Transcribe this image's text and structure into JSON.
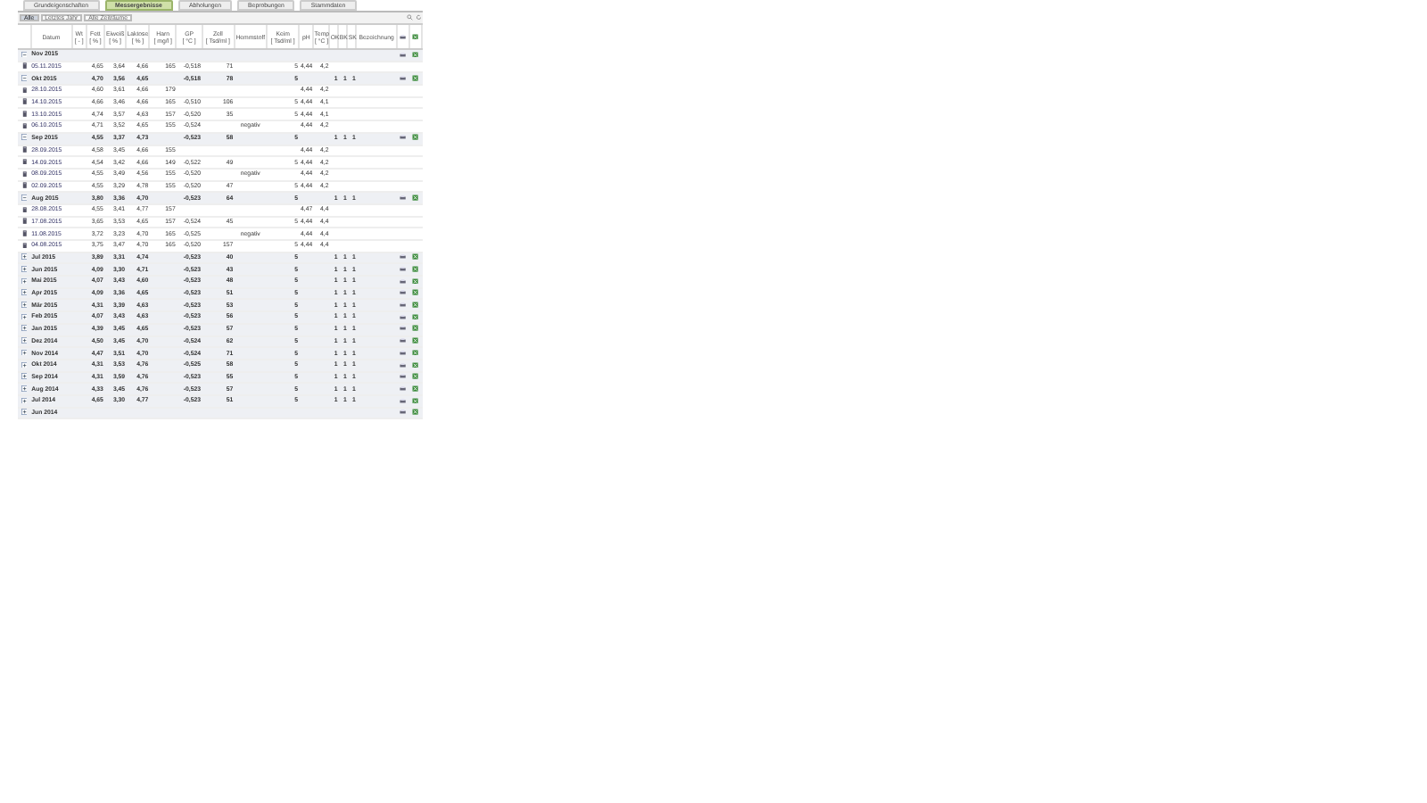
{
  "tabs": [
    {
      "label": "Grundeigenschaften",
      "selected": false
    },
    {
      "label": "Messergebnisse",
      "selected": true
    },
    {
      "label": "Abholungen",
      "selected": false
    },
    {
      "label": "Beprobungen",
      "selected": false
    },
    {
      "label": "Stammdaten",
      "selected": false
    }
  ],
  "filters": [
    {
      "label": "Alle",
      "selected": true
    },
    {
      "label": "Letztes Jahr",
      "selected": false
    },
    {
      "label": "Alle Zeiträume",
      "selected": false
    }
  ],
  "table": {
    "columns": [
      {
        "label": "Datum"
      },
      {
        "label": "Wt",
        "unit": "[ - ]"
      },
      {
        "label": "Fett",
        "unit": "[ % ]"
      },
      {
        "label": "Eiweiß",
        "unit": "[ % ]"
      },
      {
        "label": "Laktose",
        "unit": "[ % ]"
      },
      {
        "label": "Harn",
        "unit": "[ mg/l ]"
      },
      {
        "label": "GP",
        "unit": "[ °C ]"
      },
      {
        "label": "Zell",
        "unit": "[ Tsd/ml ]"
      },
      {
        "label": "Hemmstoff"
      },
      {
        "label": "Keim",
        "unit": "[ Tsd/ml ]"
      },
      {
        "label": "pH"
      },
      {
        "label": "Temp",
        "unit": "[ °C ]"
      },
      {
        "label": "OK"
      },
      {
        "label": "BK"
      },
      {
        "label": "SK"
      },
      {
        "label": "Bezeichnung"
      }
    ],
    "rows": [
      {
        "kind": "month",
        "expanded": true,
        "cells": [
          "Nov 2015"
        ]
      },
      {
        "kind": "measurement",
        "cells": [
          "05.11.2015",
          "",
          "4,65",
          "3,64",
          "4,66",
          "165",
          "-0,518",
          "71",
          "",
          "5",
          "4,44",
          "4,2"
        ]
      },
      {
        "kind": "month",
        "expanded": true,
        "cells": [
          "Okt 2015",
          "",
          "4,70",
          "3,56",
          "4,65",
          "",
          "-0,518",
          "78",
          "",
          "5",
          "",
          "",
          "1",
          "1",
          "1"
        ]
      },
      {
        "kind": "measurement",
        "cells": [
          "28.10.2015",
          "",
          "4,60",
          "3,61",
          "4,66",
          "179",
          "",
          "",
          "",
          "",
          "4,44",
          "4,2"
        ]
      },
      {
        "kind": "measurement",
        "cells": [
          "14.10.2015",
          "",
          "4,66",
          "3,46",
          "4,66",
          "165",
          "-0,510",
          "106",
          "",
          "5",
          "4,44",
          "4,1"
        ]
      },
      {
        "kind": "measurement",
        "cells": [
          "13.10.2015",
          "",
          "4,74",
          "3,57",
          "4,63",
          "157",
          "-0,520",
          "35",
          "",
          "5",
          "4,44",
          "4,1"
        ]
      },
      {
        "kind": "measurement",
        "cells": [
          "06.10.2015",
          "",
          "4,71",
          "3,52",
          "4,65",
          "155",
          "-0,524",
          "",
          "negativ",
          "",
          "4,44",
          "4,2"
        ]
      },
      {
        "kind": "month",
        "expanded": true,
        "cells": [
          "Sep 2015",
          "",
          "4,55",
          "3,37",
          "4,73",
          "",
          "-0,523",
          "58",
          "",
          "5",
          "",
          "",
          "1",
          "1",
          "1"
        ]
      },
      {
        "kind": "measurement",
        "cells": [
          "28.09.2015",
          "",
          "4,58",
          "3,45",
          "4,66",
          "155",
          "",
          "",
          "",
          "",
          "4,44",
          "4,2"
        ]
      },
      {
        "kind": "measurement",
        "cells": [
          "14.09.2015",
          "",
          "4,54",
          "3,42",
          "4,66",
          "149",
          "-0,522",
          "49",
          "",
          "5",
          "4,44",
          "4,2"
        ]
      },
      {
        "kind": "measurement",
        "cells": [
          "08.09.2015",
          "",
          "4,55",
          "3,49",
          "4,56",
          "155",
          "-0,520",
          "",
          "negativ",
          "",
          "4,44",
          "4,2"
        ]
      },
      {
        "kind": "measurement",
        "cells": [
          "02.09.2015",
          "",
          "4,55",
          "3,29",
          "4,78",
          "155",
          "-0,520",
          "47",
          "",
          "5",
          "4,44",
          "4,2"
        ]
      },
      {
        "kind": "month",
        "expanded": true,
        "cells": [
          "Aug 2015",
          "",
          "3,80",
          "3,36",
          "4,70",
          "",
          "-0,523",
          "64",
          "",
          "5",
          "",
          "",
          "1",
          "1",
          "1"
        ]
      },
      {
        "kind": "measurement",
        "cells": [
          "28.08.2015",
          "",
          "4,55",
          "3,41",
          "4,77",
          "157",
          "",
          "",
          "",
          "",
          "4,47",
          "4,4"
        ]
      },
      {
        "kind": "measurement",
        "cells": [
          "17.08.2015",
          "",
          "3,65",
          "3,53",
          "4,65",
          "157",
          "-0,524",
          "45",
          "",
          "5",
          "4,44",
          "4,4"
        ]
      },
      {
        "kind": "measurement",
        "cells": [
          "11.08.2015",
          "",
          "3,72",
          "3,23",
          "4,70",
          "165",
          "-0,525",
          "",
          "negativ",
          "",
          "4,44",
          "4,4"
        ]
      },
      {
        "kind": "measurement",
        "cells": [
          "04.08.2015",
          "",
          "3,75",
          "3,47",
          "4,70",
          "165",
          "-0,520",
          "157",
          "",
          "5",
          "4,44",
          "4,4"
        ]
      },
      {
        "kind": "month",
        "expanded": false,
        "cells": [
          "Jul 2015",
          "",
          "3,89",
          "3,31",
          "4,74",
          "",
          "-0,523",
          "40",
          "",
          "5",
          "",
          "",
          "1",
          "1",
          "1"
        ]
      },
      {
        "kind": "month",
        "expanded": false,
        "cells": [
          "Jun 2015",
          "",
          "4,09",
          "3,30",
          "4,71",
          "",
          "-0,523",
          "43",
          "",
          "5",
          "",
          "",
          "1",
          "1",
          "1"
        ]
      },
      {
        "kind": "month",
        "expanded": false,
        "cells": [
          "Mai 2015",
          "",
          "4,07",
          "3,43",
          "4,60",
          "",
          "-0,523",
          "48",
          "",
          "5",
          "",
          "",
          "1",
          "1",
          "1"
        ]
      },
      {
        "kind": "month",
        "expanded": false,
        "cells": [
          "Apr 2015",
          "",
          "4,09",
          "3,36",
          "4,65",
          "",
          "-0,523",
          "51",
          "",
          "5",
          "",
          "",
          "1",
          "1",
          "1"
        ]
      },
      {
        "kind": "month",
        "expanded": false,
        "cells": [
          "Mär 2015",
          "",
          "4,31",
          "3,39",
          "4,63",
          "",
          "-0,523",
          "53",
          "",
          "5",
          "",
          "",
          "1",
          "1",
          "1"
        ]
      },
      {
        "kind": "month",
        "expanded": false,
        "cells": [
          "Feb 2015",
          "",
          "4,07",
          "3,43",
          "4,63",
          "",
          "-0,523",
          "56",
          "",
          "5",
          "",
          "",
          "1",
          "1",
          "1"
        ]
      },
      {
        "kind": "month",
        "expanded": false,
        "cells": [
          "Jan 2015",
          "",
          "4,39",
          "3,45",
          "4,65",
          "",
          "-0,523",
          "57",
          "",
          "5",
          "",
          "",
          "1",
          "1",
          "1"
        ]
      },
      {
        "kind": "month",
        "expanded": false,
        "cells": [
          "Dez 2014",
          "",
          "4,50",
          "3,45",
          "4,70",
          "",
          "-0,524",
          "62",
          "",
          "5",
          "",
          "",
          "1",
          "1",
          "1"
        ]
      },
      {
        "kind": "month",
        "expanded": false,
        "cells": [
          "Nov 2014",
          "",
          "4,47",
          "3,51",
          "4,70",
          "",
          "-0,524",
          "71",
          "",
          "5",
          "",
          "",
          "1",
          "1",
          "1"
        ]
      },
      {
        "kind": "month",
        "expanded": false,
        "cells": [
          "Okt 2014",
          "",
          "4,31",
          "3,53",
          "4,76",
          "",
          "-0,525",
          "58",
          "",
          "5",
          "",
          "",
          "1",
          "1",
          "1"
        ]
      },
      {
        "kind": "month",
        "expanded": false,
        "cells": [
          "Sep 2014",
          "",
          "4,31",
          "3,59",
          "4,76",
          "",
          "-0,523",
          "55",
          "",
          "5",
          "",
          "",
          "1",
          "1",
          "1"
        ]
      },
      {
        "kind": "month",
        "expanded": false,
        "cells": [
          "Aug 2014",
          "",
          "4,33",
          "3,45",
          "4,76",
          "",
          "-0,523",
          "57",
          "",
          "5",
          "",
          "",
          "1",
          "1",
          "1"
        ]
      },
      {
        "kind": "month",
        "expanded": false,
        "cells": [
          "Jul 2014",
          "",
          "4,65",
          "3,30",
          "4,77",
          "",
          "-0,523",
          "51",
          "",
          "5",
          "",
          "",
          "1",
          "1",
          "1"
        ]
      },
      {
        "kind": "month",
        "expanded": false,
        "cells": [
          "Jun 2014"
        ]
      }
    ]
  }
}
